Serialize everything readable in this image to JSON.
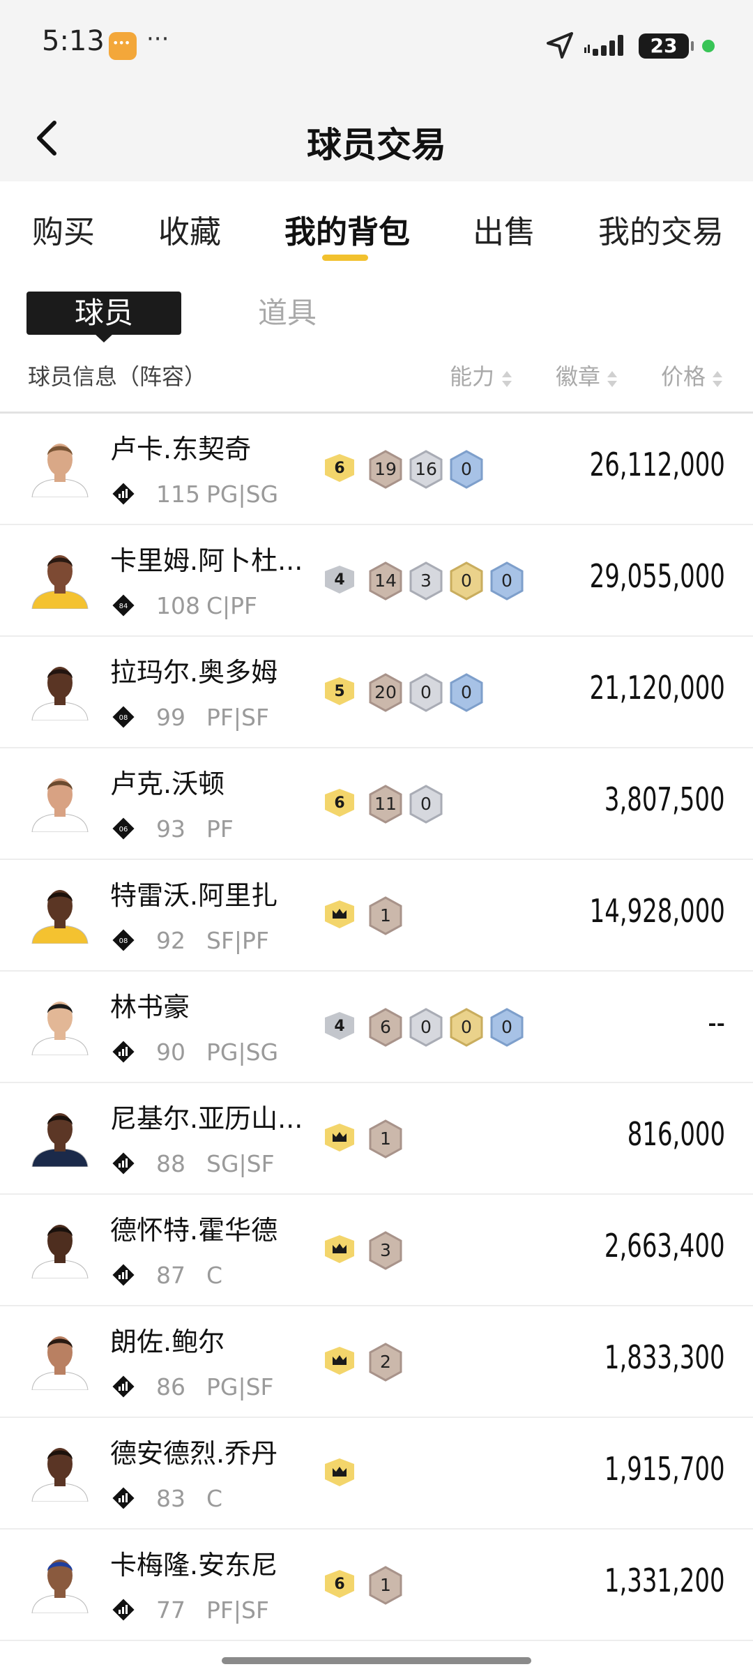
{
  "status": {
    "time": "5:13",
    "dots": "···",
    "battery": "23"
  },
  "nav": {
    "title": "球员交易"
  },
  "tabs": [
    "购买",
    "收藏",
    "我的背包",
    "出售",
    "我的交易"
  ],
  "segment": {
    "active": "球员",
    "inactive": "道具"
  },
  "columns": {
    "info": "球员信息（阵容）",
    "ability": "能力",
    "badge": "徽章",
    "price": "价格"
  },
  "colors": {
    "accent": "#f2c12e",
    "gold_badge": "#f3d56b",
    "silver_badge": "#c3c6cc",
    "bronze_chip": "#cbb8ab",
    "silver_chip": "#d6d8de",
    "gold_chip": "#ead28b",
    "blue_chip": "#a7c2e6"
  },
  "players": [
    {
      "name": "卢卡.东契奇",
      "rating": "115",
      "pos": "PG|SG",
      "tier_label": "",
      "skin": "#d9a887",
      "hair": "#7a5535",
      "jersey": "#ffffff",
      "ability": {
        "style": "gold",
        "label": "6"
      },
      "chips": [
        {
          "c": "bronze",
          "v": "19"
        },
        {
          "c": "silver",
          "v": "16"
        },
        {
          "c": "blue",
          "v": "0"
        }
      ],
      "price": "26,112,000"
    },
    {
      "name": "卡里姆.阿卜杜...",
      "rating": "108",
      "pos": "C|PF",
      "tier_label": "84",
      "skin": "#7d4a33",
      "hair": "#2a1a12",
      "jersey": "#f4c230",
      "ability": {
        "style": "silver",
        "label": "4"
      },
      "chips": [
        {
          "c": "bronze",
          "v": "14"
        },
        {
          "c": "silver",
          "v": "3"
        },
        {
          "c": "gold",
          "v": "0"
        },
        {
          "c": "blue",
          "v": "0"
        }
      ],
      "price": "29,055,000"
    },
    {
      "name": "拉玛尔.奥多姆",
      "rating": "99",
      "pos": "PF|SF",
      "tier_label": "08",
      "skin": "#5a3524",
      "hair": "#231510",
      "jersey": "#ffffff",
      "ability": {
        "style": "gold",
        "label": "5"
      },
      "chips": [
        {
          "c": "bronze",
          "v": "20"
        },
        {
          "c": "silver",
          "v": "0"
        },
        {
          "c": "blue",
          "v": "0"
        }
      ],
      "price": "21,120,000"
    },
    {
      "name": "卢克.沃顿",
      "rating": "93",
      "pos": "PF",
      "tier_label": "06",
      "skin": "#d8a283",
      "hair": "#6b4a2f",
      "jersey": "#ffffff",
      "ability": {
        "style": "gold",
        "label": "6"
      },
      "chips": [
        {
          "c": "bronze",
          "v": "11"
        },
        {
          "c": "silver",
          "v": "0"
        }
      ],
      "price": "3,807,500"
    },
    {
      "name": "特雷沃.阿里扎",
      "rating": "92",
      "pos": "SF|PF",
      "tier_label": "08",
      "skin": "#5b3624",
      "hair": "#1c110b",
      "jersey": "#f4c230",
      "ability": {
        "style": "crown",
        "label": ""
      },
      "chips": [
        {
          "c": "bronze",
          "v": "1"
        }
      ],
      "price": "14,928,000"
    },
    {
      "name": "林书豪",
      "rating": "90",
      "pos": "PG|SG",
      "tier_label": "",
      "skin": "#e2b796",
      "hair": "#1a1a1a",
      "jersey": "#ffffff",
      "ability": {
        "style": "silver",
        "label": "4"
      },
      "chips": [
        {
          "c": "bronze",
          "v": "6"
        },
        {
          "c": "silver",
          "v": "0"
        },
        {
          "c": "gold",
          "v": "0"
        },
        {
          "c": "blue",
          "v": "0"
        }
      ],
      "price": "--"
    },
    {
      "name": "尼基尔.亚历山...",
      "rating": "88",
      "pos": "SG|SF",
      "tier_label": "",
      "skin": "#5c3726",
      "hair": "#1a110c",
      "jersey": "#1b2a4a",
      "ability": {
        "style": "crown",
        "label": ""
      },
      "chips": [
        {
          "c": "bronze",
          "v": "1"
        }
      ],
      "price": "816,000"
    },
    {
      "name": "德怀特.霍华德",
      "rating": "87",
      "pos": "C",
      "tier_label": "",
      "skin": "#4e2e1f",
      "hair": "#1a110c",
      "jersey": "#ffffff",
      "ability": {
        "style": "crown",
        "label": ""
      },
      "chips": [
        {
          "c": "bronze",
          "v": "3"
        }
      ],
      "price": "2,663,400"
    },
    {
      "name": "朗佐.鲍尔",
      "rating": "86",
      "pos": "PG|SF",
      "tier_label": "",
      "skin": "#b98062",
      "hair": "#2a1a12",
      "jersey": "#ffffff",
      "ability": {
        "style": "crown",
        "label": ""
      },
      "chips": [
        {
          "c": "bronze",
          "v": "2"
        }
      ],
      "price": "1,833,300"
    },
    {
      "name": "德安德烈.乔丹",
      "rating": "83",
      "pos": "C",
      "tier_label": "",
      "skin": "#5a3525",
      "hair": "#1d120c",
      "jersey": "#ffffff",
      "ability": {
        "style": "crown",
        "label": ""
      },
      "chips": [],
      "price": "1,915,700"
    },
    {
      "name": "卡梅隆.安东尼",
      "rating": "77",
      "pos": "PF|SF",
      "tier_label": "",
      "skin": "#8a5a3e",
      "hair": "#1f3f9e",
      "jersey": "#ffffff",
      "ability": {
        "style": "gold",
        "label": "6"
      },
      "chips": [
        {
          "c": "bronze",
          "v": "1"
        }
      ],
      "price": "1,331,200"
    }
  ]
}
